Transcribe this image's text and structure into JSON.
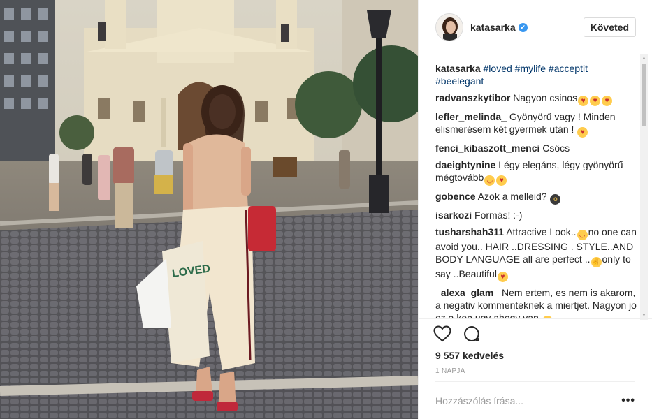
{
  "post": {
    "username": "katasarka",
    "verified": true,
    "follow_label": "Követed",
    "caption": {
      "user": "katasarka",
      "tags": [
        "#loved",
        "#mylife",
        "#acceptit",
        "#beelegant"
      ]
    },
    "comments": [
      {
        "user": "radvanszkytibor",
        "text": "Nagyon csinos",
        "emoji": [
          "heart-eyes",
          "heart-eyes",
          "heart-eyes"
        ]
      },
      {
        "user": "lefler_melinda_",
        "text": "Gyönyörű vagy ! Minden elismerésem két gyermek után !",
        "emoji": [
          "kiss"
        ]
      },
      {
        "user": "fenci_kibaszott_menci",
        "text": "Csöcs",
        "emoji": []
      },
      {
        "user": "daeightynine",
        "text": "Légy elegáns, légy gyönyörű mégtovább",
        "emoji": [
          "smile",
          "kiss"
        ]
      },
      {
        "user": "gobence",
        "text": "Azok a melleid?",
        "emoji": [
          "scream"
        ]
      },
      {
        "user": "isarkozi",
        "text": "Formás! :-)",
        "emoji": []
      },
      {
        "user": "tusharshah311",
        "text": "Attractive Look..",
        "text2": "no one can avoid you.. HAIR ..DRESSING . STYLE..AND BODY LANGUAGE all are perfect ..",
        "text3": "only to say ..Beautiful",
        "emoji": [
          "smile-hands",
          "victory",
          "kiss"
        ]
      },
      {
        "user": "_alexa_glam_",
        "text": "Nem ertem, es nem is akarom, a negativ kommenteknek a miertjet. Nagyon jo ez a kep ugy ahogy van",
        "emoji": [
          "smile"
        ]
      }
    ],
    "likes": "9 557 kedvelés",
    "time": "1 NAPJA",
    "comment_placeholder": "Hozzászólás írása...",
    "more_label": "•••",
    "icons": {
      "like": "heart-icon",
      "comment": "comment-icon"
    },
    "colors": {
      "accent": "#3897f0",
      "hashtag": "#003569",
      "muted": "#999999"
    }
  }
}
